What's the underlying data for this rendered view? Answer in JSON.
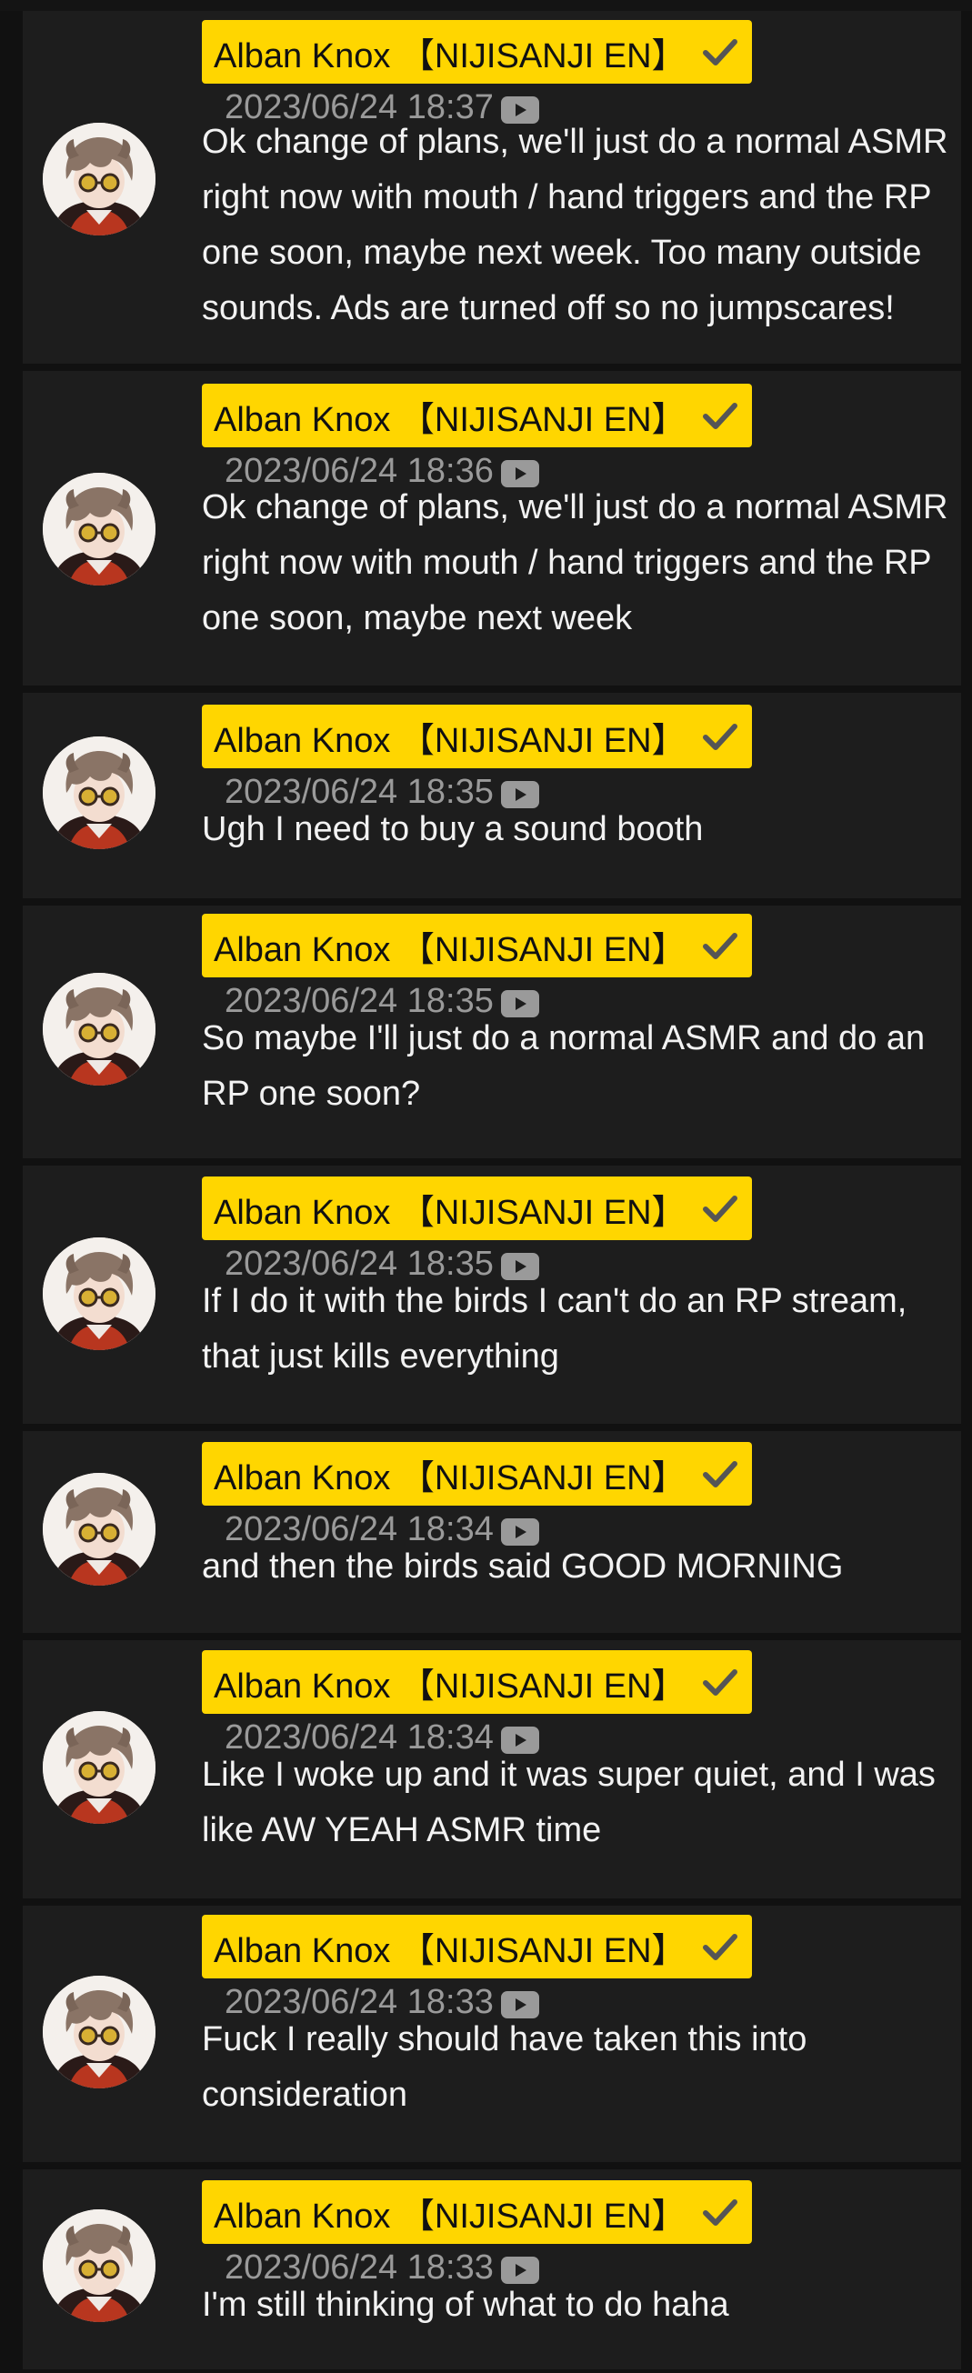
{
  "author_name": "Alban Knox 【NIJISANJI EN】",
  "colors": {
    "background": "#111111",
    "card": "#1d1d1d",
    "badge": "#ffd600",
    "timestamp": "#9a9a9a",
    "text": "#f2f2f2"
  },
  "icons": [
    "avatar",
    "verified-check-icon",
    "youtube-play-icon"
  ],
  "messages": [
    {
      "timestamp": "2023/06/24 18:37",
      "text": "Ok change of plans, we'll just do a normal ASMR\nright now with mouth / hand triggers and the RP\none soon, maybe next week. Too many outside\nsounds. Ads are turned off so no jumpscares!"
    },
    {
      "timestamp": "2023/06/24 18:36",
      "text": "Ok change of plans, we'll just do a normal ASMR\nright now with mouth / hand triggers and the RP\none soon, maybe next week"
    },
    {
      "timestamp": "2023/06/24 18:35",
      "text": "Ugh I need to buy a sound booth"
    },
    {
      "timestamp": "2023/06/24 18:35",
      "text": "So maybe I'll just do a normal ASMR and do an\nRP one soon?"
    },
    {
      "timestamp": "2023/06/24 18:35",
      "text": "If I do it with the birds I can't do an RP stream,\nthat just kills everything"
    },
    {
      "timestamp": "2023/06/24 18:34",
      "text": "and then the birds said GOOD MORNING"
    },
    {
      "timestamp": "2023/06/24 18:34",
      "text": "Like I woke up and it was super quiet, and I was\nlike AW YEAH ASMR time"
    },
    {
      "timestamp": "2023/06/24 18:33",
      "text": "Fuck I really should have taken this into\nconsideration"
    },
    {
      "timestamp": "2023/06/24 18:33",
      "text": "I'm still thinking of what to do haha"
    }
  ]
}
